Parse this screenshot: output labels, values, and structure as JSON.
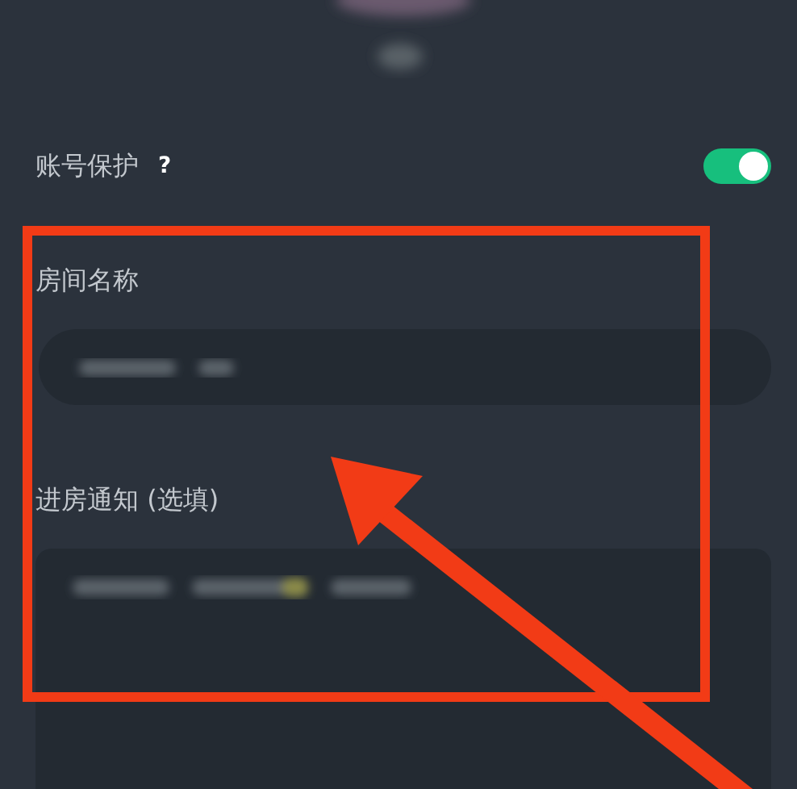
{
  "account_protection": {
    "label": "账号保护",
    "help": "?",
    "on": true
  },
  "room_name": {
    "label": "房间名称",
    "value_blurred": true
  },
  "entry_notice": {
    "label": "进房通知 (选填)",
    "value_blurred": true
  },
  "annotations": {
    "highlight_box": true,
    "pointer_arrow": true
  }
}
